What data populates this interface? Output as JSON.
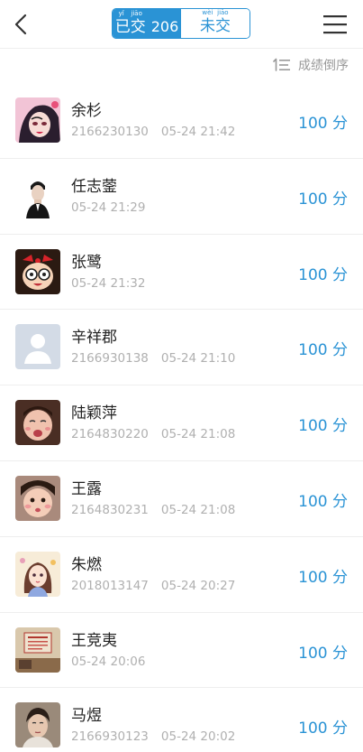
{
  "header": {
    "submitted_pinyin": [
      "yǐ",
      "jiāo"
    ],
    "submitted_label": "已交",
    "submitted_count": "206",
    "unsubmitted_pinyin": [
      "wèi",
      "jiāo"
    ],
    "unsubmitted_label": "未交",
    "accent_color": "#2a93d5"
  },
  "sort": {
    "label": "成绩倒序",
    "icon": "sort-descending-icon"
  },
  "students": [
    {
      "name": "余杉",
      "id": "2166230130",
      "time": "05-24 21:42",
      "score": "100 分",
      "avatar": "illustrated-girl-avatar"
    },
    {
      "name": "任志蓥",
      "id": "",
      "time": "05-24 21:29",
      "score": "100 分",
      "avatar": "man-portrait-avatar"
    },
    {
      "name": "张鹭",
      "id": "",
      "time": "05-24 21:32",
      "score": "100 分",
      "avatar": "cartoon-girl-glasses-avatar"
    },
    {
      "name": "辛祥郡",
      "id": "2166930138",
      "time": "05-24 21:10",
      "score": "100 分",
      "avatar": "default-user-avatar"
    },
    {
      "name": "陆颖萍",
      "id": "2164830220",
      "time": "05-24 21:08",
      "score": "100 分",
      "avatar": "crying-child-avatar"
    },
    {
      "name": "王露",
      "id": "2164830231",
      "time": "05-24 21:08",
      "score": "100 分",
      "avatar": "pouting-child-avatar"
    },
    {
      "name": "朱燃",
      "id": "2018013147",
      "time": "05-24 20:27",
      "score": "100 分",
      "avatar": "anime-girl-avatar"
    },
    {
      "name": "王竞夷",
      "id": "",
      "time": "05-24 20:06",
      "score": "100 分",
      "avatar": "room-photo-avatar"
    },
    {
      "name": "马煜",
      "id": "2166930123",
      "time": "05-24 20:02",
      "score": "100 分",
      "avatar": "young-man-avatar"
    }
  ]
}
